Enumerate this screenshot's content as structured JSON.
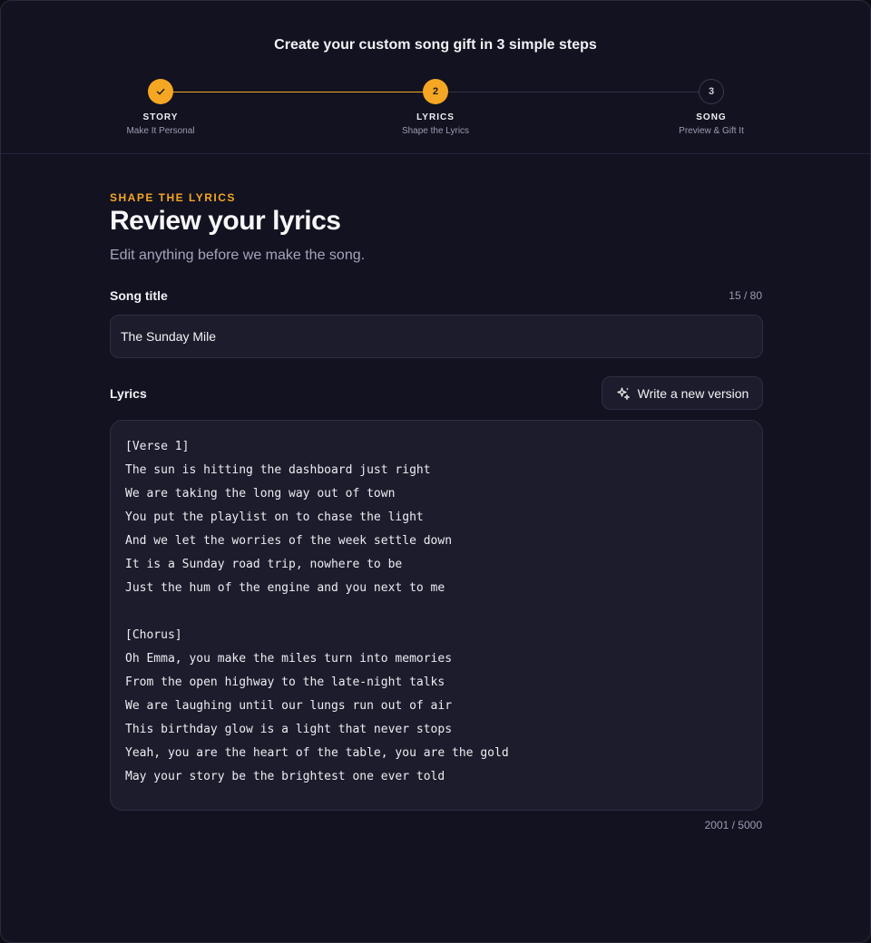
{
  "header": {
    "title": "Create your custom song gift in 3 simple steps",
    "steps": [
      {
        "number": "1",
        "label": "STORY",
        "sub": "Make It Personal",
        "state": "done",
        "icon": "check-icon"
      },
      {
        "number": "2",
        "label": "LYRICS",
        "sub": "Shape the Lyrics",
        "state": "active"
      },
      {
        "number": "3",
        "label": "SONG",
        "sub": "Preview & Gift It",
        "state": "upcoming"
      }
    ]
  },
  "main": {
    "eyebrow": "SHAPE THE LYRICS",
    "heading": "Review your lyrics",
    "subheading": "Edit anything before we make the song.",
    "song_title": {
      "label": "Song title",
      "counter": "15 / 80",
      "value": "The Sunday Mile"
    },
    "lyrics": {
      "label": "Lyrics",
      "rewrite_button": "Write a new version",
      "rewrite_icon": "sparkles-icon",
      "counter": "2001 / 5000",
      "value": "[Verse 1]\nThe sun is hitting the dashboard just right\nWe are taking the long way out of town\nYou put the playlist on to chase the light\nAnd we let the worries of the week settle down\nIt is a Sunday road trip, nowhere to be\nJust the hum of the engine and you next to me\n\n[Chorus]\nOh Emma, you make the miles turn into memories\nFrom the open highway to the late-night talks\nWe are laughing until our lungs run out of air\nThis birthday glow is a light that never stops\nYeah, you are the heart of the table, you are the gold\nMay your story be the brightest one ever told"
    }
  },
  "colors": {
    "accent": "#f5a623",
    "background": "#121220",
    "surface": "#1c1c2c"
  }
}
